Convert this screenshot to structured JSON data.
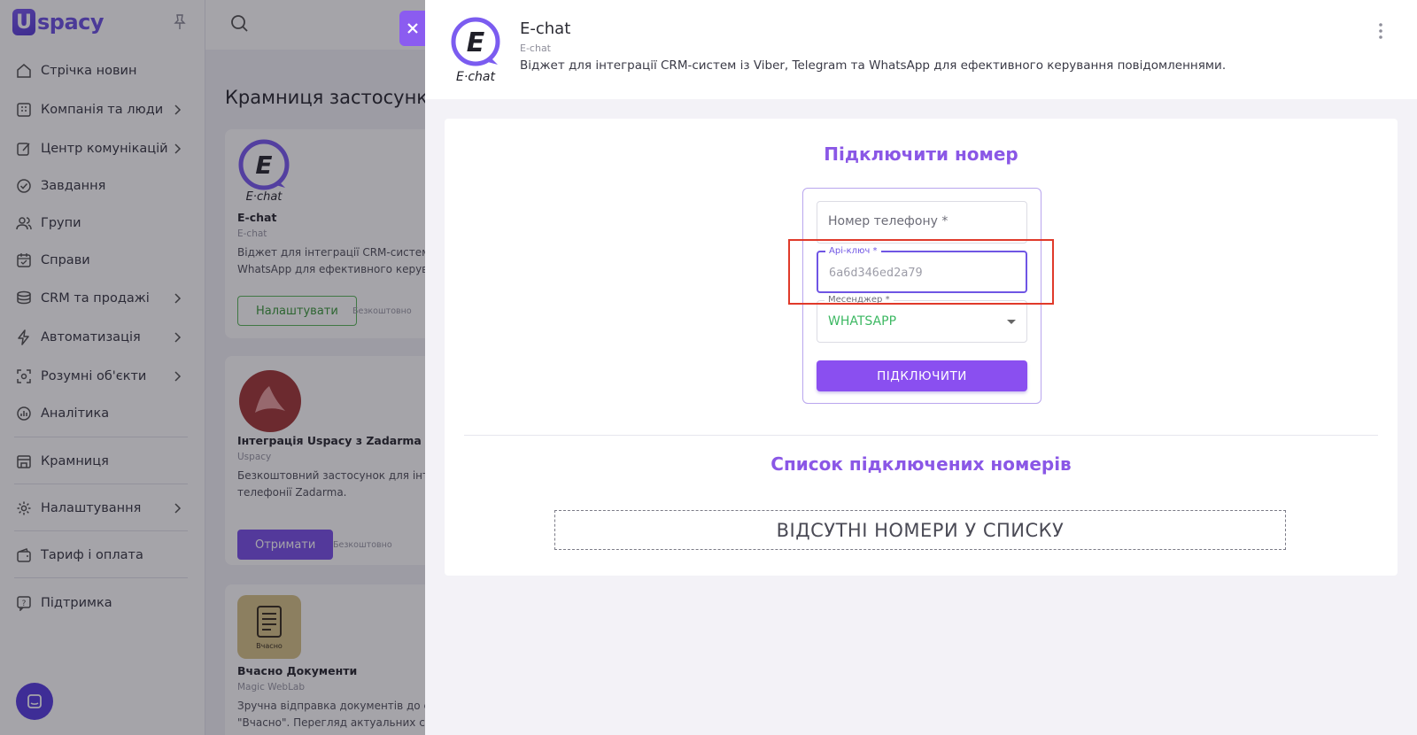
{
  "brand": {
    "logo_letter": "U",
    "logo_text": "spacy"
  },
  "sidebar": {
    "items": [
      {
        "label": "Стрічка новин",
        "icon": "home-icon",
        "chevron": false
      },
      {
        "label": "Компанія та люди",
        "icon": "building-icon",
        "chevron": true
      },
      {
        "label": "Центр комунікацій",
        "icon": "edit-icon",
        "chevron": true
      },
      {
        "label": "Завдання",
        "icon": "check-circle-icon",
        "chevron": false
      },
      {
        "label": "Групи",
        "icon": "users-icon",
        "chevron": false
      },
      {
        "label": "Справи",
        "icon": "calendar-icon",
        "chevron": false
      },
      {
        "label": "CRM та продажі",
        "icon": "coins-icon",
        "chevron": true
      },
      {
        "label": "Автоматизація",
        "icon": "bolt-icon",
        "chevron": true
      },
      {
        "label": "Розумні об'єкти",
        "icon": "scan-icon",
        "chevron": true
      },
      {
        "label": "Аналітика",
        "icon": "chart-icon",
        "chevron": false
      },
      {
        "label": "Крамниця",
        "icon": "store-icon",
        "chevron": false
      },
      {
        "label": "Налаштування",
        "icon": "gear-icon",
        "chevron": true
      },
      {
        "label": "Тариф і оплата",
        "icon": "wallet-icon",
        "chevron": false
      },
      {
        "label": "Підтримка",
        "icon": "help-icon",
        "chevron": false
      }
    ]
  },
  "store": {
    "title": "Крамниця застосунків",
    "cards": [
      {
        "name": "E-chat",
        "vendor": "E-chat",
        "desc_line1": "Віджет для інтеграції CRM-систем",
        "desc_line2": "WhatsApp для ефективного керува",
        "button": "Налаштувати",
        "price": "Безкоштовно",
        "logo_text": "E·chat"
      },
      {
        "name": "Інтеграція Uspacy з Zadarma",
        "vendor": "Uspacy",
        "desc_line1": "Безкоштовний застосунок для інте",
        "desc_line2": "телефонії Zadarma.",
        "button": "Отримати",
        "price": "Безкоштовно"
      },
      {
        "name": "Вчасно Документи",
        "vendor": "Magic WebLab",
        "desc_line1": "Зручна відправка документів до с",
        "desc_line2": "\"Вчасно\". Перегляд актуальних ст",
        "logo_caption": "Вчасно"
      }
    ]
  },
  "drawer": {
    "logo_text": "E·chat",
    "title": "E-chat",
    "vendor": "E-chat",
    "description": "Віджет для інтеграції CRM-систем із Viber, Telegram та WhatsApp для ефективного керування повідомленнями.",
    "connect_title": "Підключити номер",
    "phone_placeholder": "Номер телефону *",
    "api_label": "Api-ключ *",
    "api_value": "6a6d346ed2a79",
    "messenger_label": "Месенджер *",
    "messenger_value": "WHATSAPP",
    "connect_button": "ПІДКЛЮЧИТИ",
    "list_title": "Список підключених номерів",
    "empty_text": "ВІДСУТНІ НОМЕРИ У СПИСКУ"
  },
  "colors": {
    "accent": "#8a4ff0",
    "brand": "#6f55e4",
    "highlight": "#e03a2a",
    "success": "#3cb862"
  }
}
